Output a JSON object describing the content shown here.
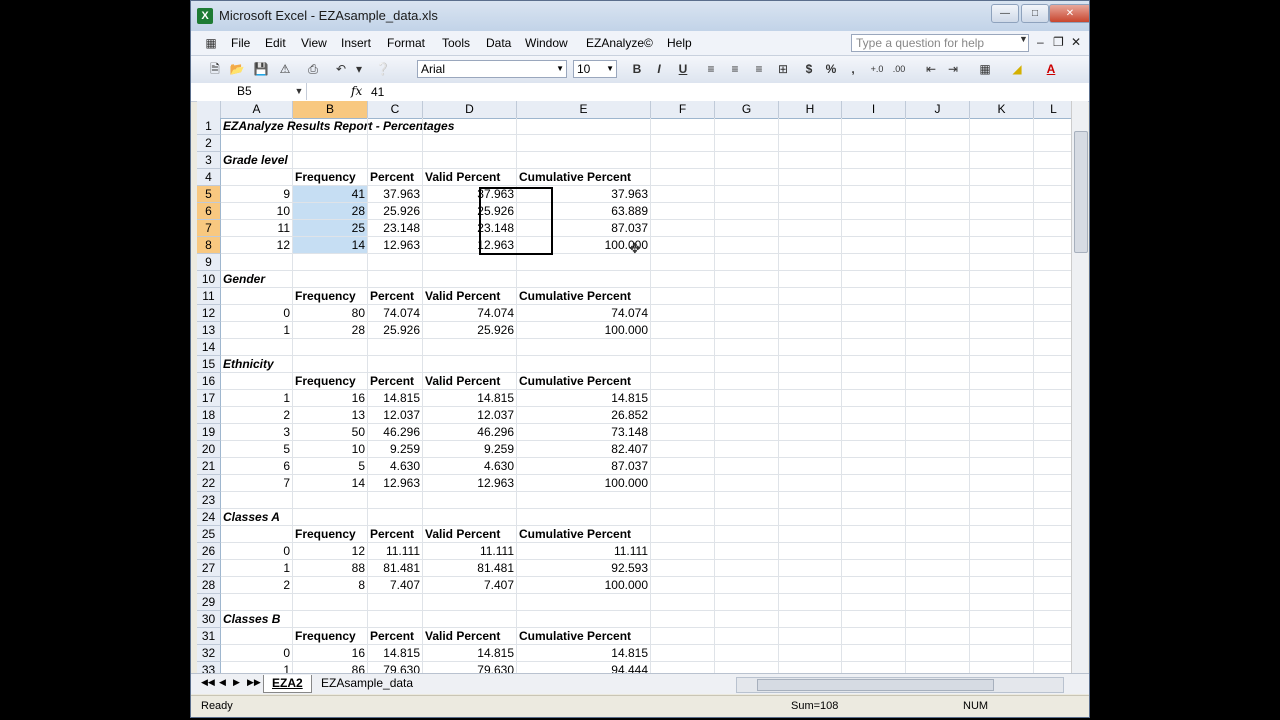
{
  "window": {
    "title": "Microsoft Excel - EZAsample_data.xls"
  },
  "menu": [
    "File",
    "Edit",
    "View",
    "Insert",
    "Format",
    "Tools",
    "Data",
    "Window",
    "EZAnalyze©",
    "Help"
  ],
  "help_placeholder": "Type a question for help",
  "toolbar": {
    "font": "Arial",
    "size": "10"
  },
  "formula": {
    "namebox": "B5",
    "fx": "fx",
    "value": "41"
  },
  "columns": [
    "A",
    "B",
    "C",
    "D",
    "E",
    "F",
    "G",
    "H",
    "I",
    "J",
    "K",
    "L"
  ],
  "selected_column": "B",
  "rows": [
    {
      "n": "1",
      "cells": [
        [
          "EZAnalyze Results Report - Percentages",
          "bi"
        ]
      ]
    },
    {
      "n": "2",
      "cells": []
    },
    {
      "n": "3",
      "cells": [
        [
          "Grade level",
          "bi"
        ]
      ]
    },
    {
      "n": "4",
      "cells": [
        [
          "",
          ""
        ],
        [
          "Frequency",
          "bold"
        ],
        [
          "Percent",
          "bold"
        ],
        [
          "Valid Percent",
          "bold"
        ],
        [
          "Cumulative Percent",
          "bold"
        ]
      ]
    },
    {
      "n": "5",
      "sel": true,
      "cells": [
        [
          "9",
          "num"
        ],
        [
          "41",
          "num hl"
        ],
        [
          "37.963",
          "num"
        ],
        [
          "37.963",
          "num"
        ],
        [
          "37.963",
          "num"
        ]
      ]
    },
    {
      "n": "6",
      "sel": true,
      "cells": [
        [
          "10",
          "num"
        ],
        [
          "28",
          "num hl"
        ],
        [
          "25.926",
          "num"
        ],
        [
          "25.926",
          "num"
        ],
        [
          "63.889",
          "num"
        ]
      ]
    },
    {
      "n": "7",
      "sel": true,
      "cells": [
        [
          "11",
          "num"
        ],
        [
          "25",
          "num hl"
        ],
        [
          "23.148",
          "num"
        ],
        [
          "23.148",
          "num"
        ],
        [
          "87.037",
          "num"
        ]
      ]
    },
    {
      "n": "8",
      "sel": true,
      "cells": [
        [
          "12",
          "num"
        ],
        [
          "14",
          "num hl"
        ],
        [
          "12.963",
          "num"
        ],
        [
          "12.963",
          "num"
        ],
        [
          "100.000",
          "num"
        ]
      ]
    },
    {
      "n": "9",
      "cells": []
    },
    {
      "n": "10",
      "cells": [
        [
          "Gender",
          "bi"
        ]
      ]
    },
    {
      "n": "11",
      "cells": [
        [
          "",
          ""
        ],
        [
          "Frequency",
          "bold"
        ],
        [
          "Percent",
          "bold"
        ],
        [
          "Valid Percent",
          "bold"
        ],
        [
          "Cumulative Percent",
          "bold"
        ]
      ]
    },
    {
      "n": "12",
      "cells": [
        [
          "0",
          "num"
        ],
        [
          "80",
          "num"
        ],
        [
          "74.074",
          "num"
        ],
        [
          "74.074",
          "num"
        ],
        [
          "74.074",
          "num"
        ]
      ]
    },
    {
      "n": "13",
      "cells": [
        [
          "1",
          "num"
        ],
        [
          "28",
          "num"
        ],
        [
          "25.926",
          "num"
        ],
        [
          "25.926",
          "num"
        ],
        [
          "100.000",
          "num"
        ]
      ]
    },
    {
      "n": "14",
      "cells": []
    },
    {
      "n": "15",
      "cells": [
        [
          "Ethnicity",
          "bi"
        ]
      ]
    },
    {
      "n": "16",
      "cells": [
        [
          "",
          ""
        ],
        [
          "Frequency",
          "bold"
        ],
        [
          "Percent",
          "bold"
        ],
        [
          "Valid Percent",
          "bold"
        ],
        [
          "Cumulative Percent",
          "bold"
        ]
      ]
    },
    {
      "n": "17",
      "cells": [
        [
          "1",
          "num"
        ],
        [
          "16",
          "num"
        ],
        [
          "14.815",
          "num"
        ],
        [
          "14.815",
          "num"
        ],
        [
          "14.815",
          "num"
        ]
      ]
    },
    {
      "n": "18",
      "cells": [
        [
          "2",
          "num"
        ],
        [
          "13",
          "num"
        ],
        [
          "12.037",
          "num"
        ],
        [
          "12.037",
          "num"
        ],
        [
          "26.852",
          "num"
        ]
      ]
    },
    {
      "n": "19",
      "cells": [
        [
          "3",
          "num"
        ],
        [
          "50",
          "num"
        ],
        [
          "46.296",
          "num"
        ],
        [
          "46.296",
          "num"
        ],
        [
          "73.148",
          "num"
        ]
      ]
    },
    {
      "n": "20",
      "cells": [
        [
          "5",
          "num"
        ],
        [
          "10",
          "num"
        ],
        [
          "9.259",
          "num"
        ],
        [
          "9.259",
          "num"
        ],
        [
          "82.407",
          "num"
        ]
      ]
    },
    {
      "n": "21",
      "cells": [
        [
          "6",
          "num"
        ],
        [
          "5",
          "num"
        ],
        [
          "4.630",
          "num"
        ],
        [
          "4.630",
          "num"
        ],
        [
          "87.037",
          "num"
        ]
      ]
    },
    {
      "n": "22",
      "cells": [
        [
          "7",
          "num"
        ],
        [
          "14",
          "num"
        ],
        [
          "12.963",
          "num"
        ],
        [
          "12.963",
          "num"
        ],
        [
          "100.000",
          "num"
        ]
      ]
    },
    {
      "n": "23",
      "cells": []
    },
    {
      "n": "24",
      "cells": [
        [
          "Classes A",
          "bi"
        ]
      ]
    },
    {
      "n": "25",
      "cells": [
        [
          "",
          ""
        ],
        [
          "Frequency",
          "bold"
        ],
        [
          "Percent",
          "bold"
        ],
        [
          "Valid Percent",
          "bold"
        ],
        [
          "Cumulative Percent",
          "bold"
        ]
      ]
    },
    {
      "n": "26",
      "cells": [
        [
          "0",
          "num"
        ],
        [
          "12",
          "num"
        ],
        [
          "11.111",
          "num"
        ],
        [
          "11.111",
          "num"
        ],
        [
          "11.111",
          "num"
        ]
      ]
    },
    {
      "n": "27",
      "cells": [
        [
          "1",
          "num"
        ],
        [
          "88",
          "num"
        ],
        [
          "81.481",
          "num"
        ],
        [
          "81.481",
          "num"
        ],
        [
          "92.593",
          "num"
        ]
      ]
    },
    {
      "n": "28",
      "cells": [
        [
          "2",
          "num"
        ],
        [
          "8",
          "num"
        ],
        [
          "7.407",
          "num"
        ],
        [
          "7.407",
          "num"
        ],
        [
          "100.000",
          "num"
        ]
      ]
    },
    {
      "n": "29",
      "cells": []
    },
    {
      "n": "30",
      "cells": [
        [
          "Classes B",
          "bi"
        ]
      ]
    },
    {
      "n": "31",
      "cells": [
        [
          "",
          ""
        ],
        [
          "Frequency",
          "bold"
        ],
        [
          "Percent",
          "bold"
        ],
        [
          "Valid Percent",
          "bold"
        ],
        [
          "Cumulative Percent",
          "bold"
        ]
      ]
    },
    {
      "n": "32",
      "cells": [
        [
          "0",
          "num"
        ],
        [
          "16",
          "num"
        ],
        [
          "14.815",
          "num"
        ],
        [
          "14.815",
          "num"
        ],
        [
          "14.815",
          "num"
        ]
      ]
    },
    {
      "n": "33",
      "cells": [
        [
          "1",
          "num"
        ],
        [
          "86",
          "num"
        ],
        [
          "79.630",
          "num"
        ],
        [
          "79.630",
          "num"
        ],
        [
          "94.444",
          "num"
        ]
      ]
    }
  ],
  "sheets": [
    {
      "name": "EZA2",
      "active": true
    },
    {
      "name": "EZAsample_data",
      "active": false
    }
  ],
  "status": {
    "left": "Ready",
    "sum": "Sum=108",
    "num": "NUM"
  }
}
